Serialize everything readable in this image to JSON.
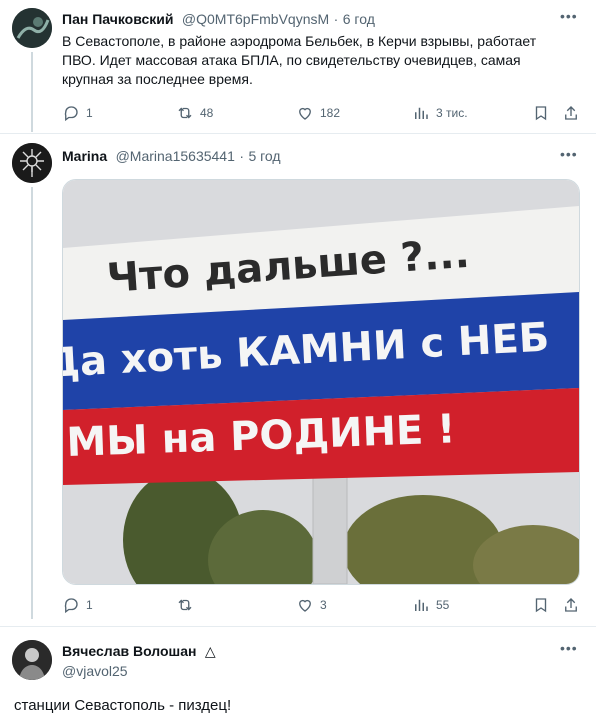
{
  "tweet1": {
    "name": "Пан Пачковский",
    "handle": "@Q0MT6pFmbVqynsM",
    "sep": "·",
    "time": "6 год",
    "text": "В Севастополе, в районе аэродрома Бельбек, в Керчи взрывы, работает ПВО. Идет массовая атака БПЛА, по свидетельству очевидцев, самая крупная за последнее время.",
    "replies": "1",
    "retweets": "48",
    "likes": "182",
    "views": "3 тис."
  },
  "tweet2": {
    "name": "Marina",
    "handle": "@Marina15635441",
    "sep": "·",
    "time": "5 год",
    "image": {
      "line1": "Что дальше ?...",
      "line2": "Да хоть КАМНИ с НЕБ",
      "line3": "МЫ на РОДИНЕ !"
    },
    "replies": "1",
    "retweets": "",
    "likes": "3",
    "views": "55"
  },
  "tweet3": {
    "name": "Вячеслав Волошан",
    "badge": "△",
    "handle": "@vjavol25",
    "text": "станции Севастополь - пиздец!"
  },
  "colors": {
    "text": "#0f1419",
    "muted": "#536471",
    "border": "#cfd9de",
    "billboard_white": "#f2f2f0",
    "billboard_blue": "#1f43a8",
    "billboard_red": "#d1202b",
    "sky": "#d9dadd"
  },
  "icons": [
    "reply-icon",
    "retweet-icon",
    "like-icon",
    "views-icon",
    "bookmark-icon",
    "share-icon",
    "more-icon"
  ]
}
